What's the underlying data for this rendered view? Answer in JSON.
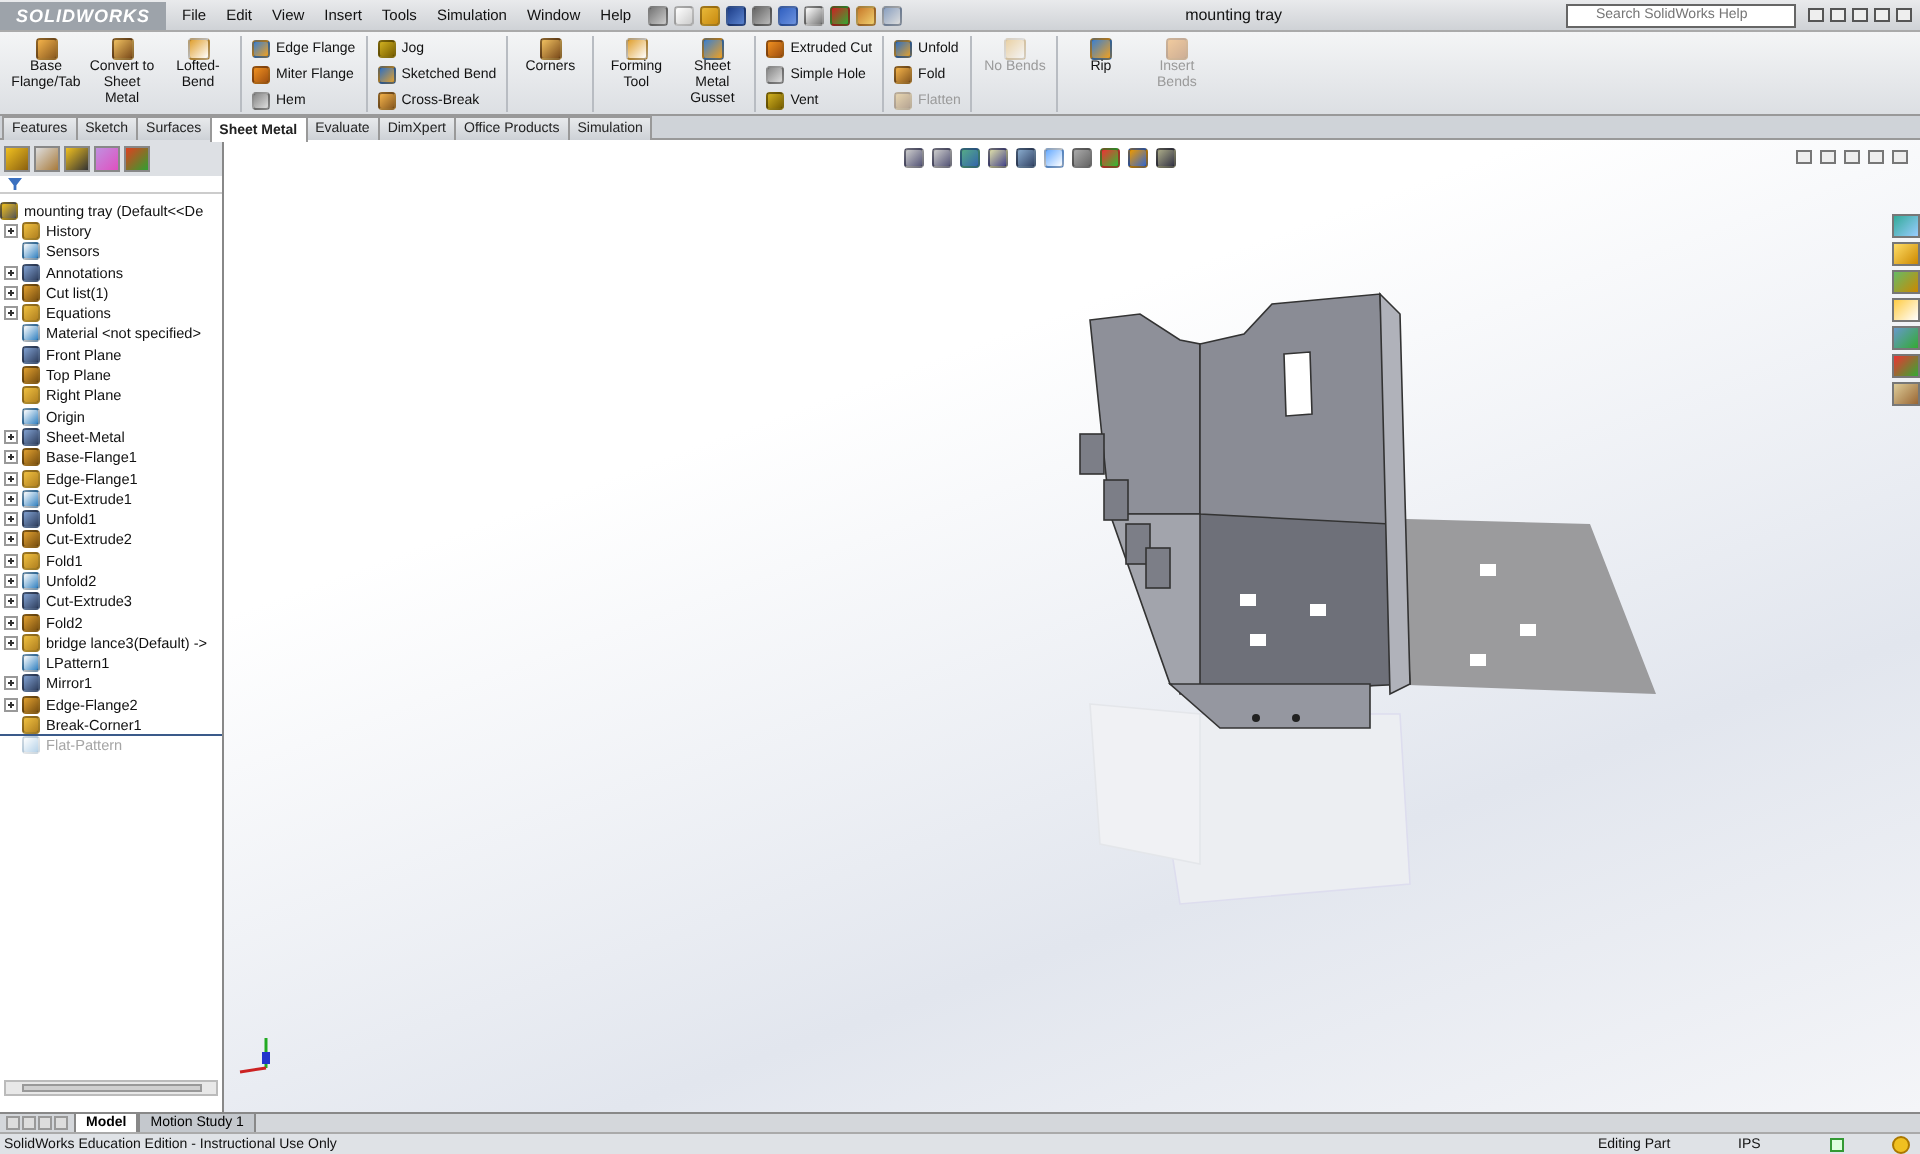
{
  "window": {
    "title": "mounting tray",
    "logo": "SOLIDWORKS"
  },
  "menu": [
    "File",
    "Edit",
    "View",
    "Insert",
    "Tools",
    "Simulation",
    "Window",
    "Help"
  ],
  "search": {
    "placeholder": "Search SolidWorks Help"
  },
  "ribbon": [
    {
      "kind": "large",
      "buttons": [
        {
          "label": "Base Flange/Tab",
          "disabled": false
        },
        {
          "label": "Convert to Sheet Metal",
          "disabled": false
        },
        {
          "label": "Lofted-Bend",
          "disabled": false
        }
      ]
    },
    {
      "kind": "small",
      "buttons": [
        {
          "label": "Edge Flange",
          "disabled": false
        },
        {
          "label": "Miter Flange",
          "disabled": false
        },
        {
          "label": "Hem",
          "disabled": false
        }
      ]
    },
    {
      "kind": "small",
      "buttons": [
        {
          "label": "Jog",
          "disabled": false
        },
        {
          "label": "Sketched Bend",
          "disabled": false
        },
        {
          "label": "Cross-Break",
          "disabled": false
        }
      ]
    },
    {
      "kind": "large",
      "buttons": [
        {
          "label": "Corners",
          "disabled": false
        }
      ]
    },
    {
      "kind": "large",
      "buttons": [
        {
          "label": "Forming Tool",
          "disabled": false
        },
        {
          "label": "Sheet Metal Gusset",
          "disabled": false
        }
      ]
    },
    {
      "kind": "small",
      "buttons": [
        {
          "label": "Extruded Cut",
          "disabled": false
        },
        {
          "label": "Simple Hole",
          "disabled": false
        },
        {
          "label": "Vent",
          "disabled": false
        }
      ]
    },
    {
      "kind": "small",
      "buttons": [
        {
          "label": "Unfold",
          "disabled": false
        },
        {
          "label": "Fold",
          "disabled": false
        },
        {
          "label": "Flatten",
          "disabled": true
        }
      ]
    },
    {
      "kind": "large",
      "buttons": [
        {
          "label": "No Bends",
          "disabled": true
        }
      ]
    },
    {
      "kind": "large",
      "buttons": [
        {
          "label": "Rip",
          "disabled": false
        },
        {
          "label": "Insert Bends",
          "disabled": true
        }
      ]
    }
  ],
  "tabs": [
    {
      "label": "Features",
      "selected": false
    },
    {
      "label": "Sketch",
      "selected": false
    },
    {
      "label": "Surfaces",
      "selected": false
    },
    {
      "label": "Sheet Metal",
      "selected": true
    },
    {
      "label": "Evaluate",
      "selected": false
    },
    {
      "label": "DimXpert",
      "selected": false
    },
    {
      "label": "Office Products",
      "selected": false
    },
    {
      "label": "Simulation",
      "selected": false
    }
  ],
  "tree": {
    "label": "mounting tray  (Default<<De",
    "children": [
      {
        "label": "History",
        "expanded": false,
        "disabled": false
      },
      {
        "label": "Sensors",
        "disabled": false
      },
      {
        "label": "Annotations",
        "expanded": false,
        "disabled": false
      },
      {
        "label": "Cut list(1)",
        "expanded": false,
        "disabled": false
      },
      {
        "label": "Equations",
        "expanded": false,
        "disabled": false
      },
      {
        "label": "Material <not specified>",
        "disabled": false
      },
      {
        "label": "Front Plane",
        "disabled": false
      },
      {
        "label": "Top Plane",
        "disabled": false
      },
      {
        "label": "Right Plane",
        "disabled": false
      },
      {
        "label": "Origin",
        "disabled": false
      },
      {
        "label": "Sheet-Metal",
        "expanded": false,
        "disabled": false
      },
      {
        "label": "Base-Flange1",
        "expanded": false,
        "disabled": false
      },
      {
        "label": "Edge-Flange1",
        "expanded": false,
        "disabled": false
      },
      {
        "label": "Cut-Extrude1",
        "expanded": false,
        "disabled": false
      },
      {
        "label": "Unfold1",
        "expanded": false,
        "disabled": false
      },
      {
        "label": "Cut-Extrude2",
        "expanded": false,
        "disabled": false
      },
      {
        "label": "Fold1",
        "expanded": false,
        "disabled": false
      },
      {
        "label": "Unfold2",
        "expanded": false,
        "disabled": false
      },
      {
        "label": "Cut-Extrude3",
        "expanded": false,
        "disabled": false
      },
      {
        "label": "Fold2",
        "expanded": false,
        "disabled": false
      },
      {
        "label": "bridge lance3(Default) ->",
        "expanded": false,
        "disabled": false
      },
      {
        "label": "LPattern1",
        "disabled": false
      },
      {
        "label": "Mirror1",
        "expanded": false,
        "disabled": false
      },
      {
        "label": "Edge-Flange2",
        "expanded": false,
        "disabled": false
      },
      {
        "label": "Break-Corner1",
        "disabled": false
      },
      {
        "label": "Flat-Pattern",
        "disabled": true
      }
    ]
  },
  "bottom_tabs": [
    {
      "label": "Model",
      "selected": true
    },
    {
      "label": "Motion Study 1",
      "selected": false
    }
  ],
  "status_bar": {
    "edition": "SolidWorks Education Edition - Instructional Use Only",
    "mode": "Editing Part",
    "units": "IPS"
  }
}
